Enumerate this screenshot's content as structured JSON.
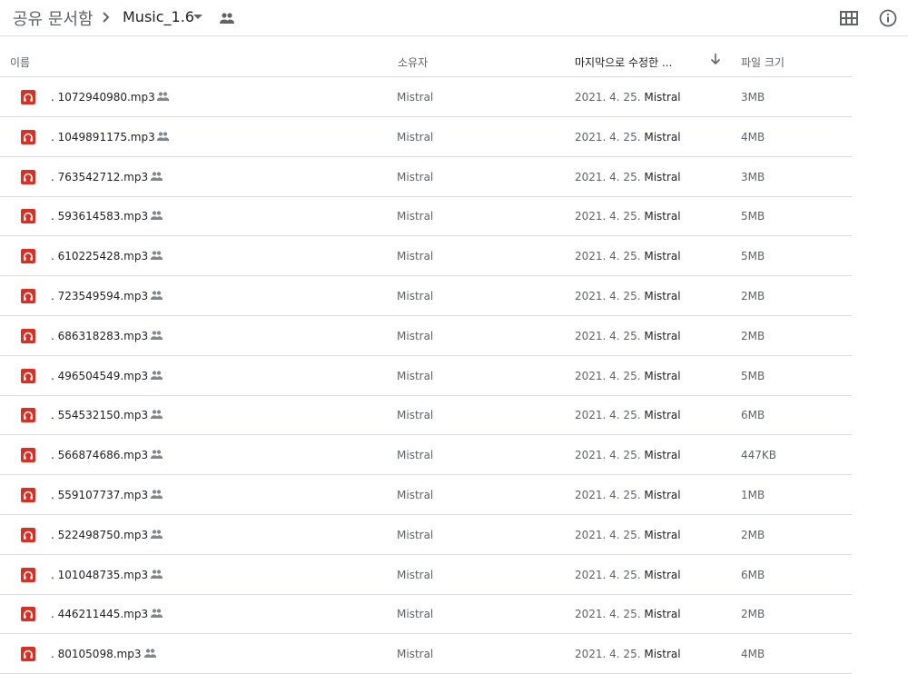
{
  "breadcrumb": {
    "root": "공유 문서함",
    "current": "Music_1.6"
  },
  "toolbar": {
    "grid_icon": "grid-view-icon",
    "info_icon": "info-icon"
  },
  "table": {
    "headers": {
      "name": "이름",
      "owner": "소유자",
      "modified": "마지막으로 수정한 ...",
      "size": "파일 크기"
    },
    "rows": [
      {
        "name": ". 1072940980.mp3",
        "owner": "Mistral",
        "date": "2021. 4. 25.",
        "by": "Mistral",
        "size": "3MB"
      },
      {
        "name": ". 1049891175.mp3",
        "owner": "Mistral",
        "date": "2021. 4. 25.",
        "by": "Mistral",
        "size": "4MB"
      },
      {
        "name": ". 763542712.mp3",
        "owner": "Mistral",
        "date": "2021. 4. 25.",
        "by": "Mistral",
        "size": "3MB"
      },
      {
        "name": ". 593614583.mp3",
        "owner": "Mistral",
        "date": "2021. 4. 25.",
        "by": "Mistral",
        "size": "5MB"
      },
      {
        "name": ". 610225428.mp3",
        "owner": "Mistral",
        "date": "2021. 4. 25.",
        "by": "Mistral",
        "size": "5MB"
      },
      {
        "name": ". 723549594.mp3",
        "owner": "Mistral",
        "date": "2021. 4. 25.",
        "by": "Mistral",
        "size": "2MB"
      },
      {
        "name": ". 686318283.mp3",
        "owner": "Mistral",
        "date": "2021. 4. 25.",
        "by": "Mistral",
        "size": "2MB"
      },
      {
        "name": ". 496504549.mp3",
        "owner": "Mistral",
        "date": "2021. 4. 25.",
        "by": "Mistral",
        "size": "5MB"
      },
      {
        "name": ". 554532150.mp3",
        "owner": "Mistral",
        "date": "2021. 4. 25.",
        "by": "Mistral",
        "size": "6MB"
      },
      {
        "name": ". 566874686.mp3",
        "owner": "Mistral",
        "date": "2021. 4. 25.",
        "by": "Mistral",
        "size": "447KB"
      },
      {
        "name": ". 559107737.mp3",
        "owner": "Mistral",
        "date": "2021. 4. 25.",
        "by": "Mistral",
        "size": "1MB"
      },
      {
        "name": ". 522498750.mp3",
        "owner": "Mistral",
        "date": "2021. 4. 25.",
        "by": "Mistral",
        "size": "2MB"
      },
      {
        "name": ". 101048735.mp3",
        "owner": "Mistral",
        "date": "2021. 4. 25.",
        "by": "Mistral",
        "size": "6MB"
      },
      {
        "name": ". 446211445.mp3",
        "owner": "Mistral",
        "date": "2021. 4. 25.",
        "by": "Mistral",
        "size": "2MB"
      },
      {
        "name": ". 80105098.mp3",
        "owner": "Mistral",
        "date": "2021. 4. 25.",
        "by": "Mistral",
        "size": "4MB"
      }
    ]
  },
  "colors": {
    "audio_icon": "#d93025",
    "divider": "#dadce0",
    "muted_text": "#5f6368"
  }
}
